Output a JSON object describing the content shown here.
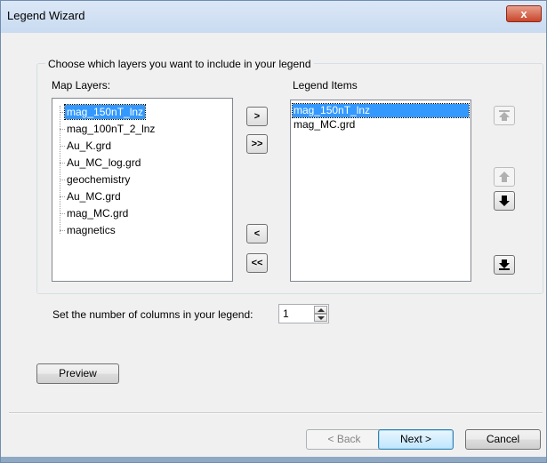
{
  "window": {
    "title": "Legend Wizard",
    "close_label": "x"
  },
  "group": {
    "caption": "Choose which layers you want to include in your legend"
  },
  "map_layers": {
    "label": "Map Layers:",
    "items": [
      "mag_150nT_lnz",
      "mag_100nT_2_lnz",
      "Au_K.grd",
      "Au_MC_log.grd",
      "geochemistry",
      "Au_MC.grd",
      "mag_MC.grd",
      "magnetics"
    ],
    "selected_index": 0
  },
  "legend_items": {
    "label": "Legend Items",
    "items": [
      "mag_150nT_lnz",
      "mag_MC.grd"
    ],
    "selected_index": 0
  },
  "transfer_buttons": {
    "add": ">",
    "add_all": ">>",
    "remove": "<",
    "remove_all": "<<"
  },
  "order_buttons": {
    "move_top": "move-top-icon",
    "move_up": "move-up-icon",
    "move_down": "move-down-icon",
    "move_bottom": "move-bottom-icon"
  },
  "columns": {
    "label": "Set the number of columns in your legend:",
    "value": "1"
  },
  "buttons": {
    "preview": "Preview",
    "back": "< Back",
    "next": "Next >",
    "cancel": "Cancel"
  }
}
